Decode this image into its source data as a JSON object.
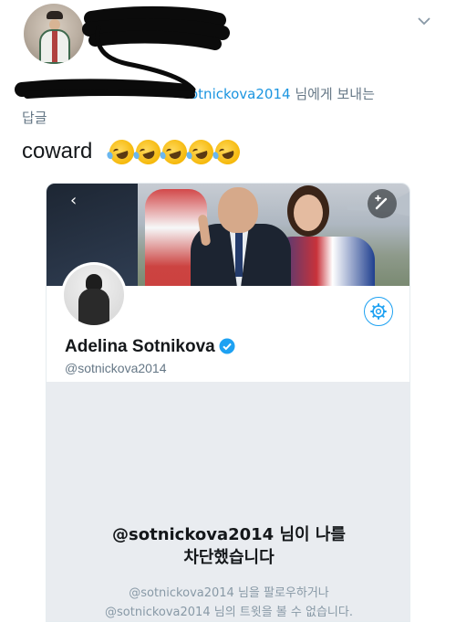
{
  "reply": {
    "handle_visible": "otnickova2014",
    "suffix": " 님에게 보내는",
    "line2": "답글"
  },
  "tweet": {
    "text": "coward",
    "emoji_name": "rolling-on-the-floor-laughing-emoji",
    "emoji_count": 5
  },
  "icons": {
    "chevron": "chevron-down-icon",
    "back": "back-arrow-icon",
    "compose": "compose-icon",
    "settings": "gear-icon",
    "verified": "verified-badge-icon"
  },
  "embedded_profile": {
    "back_glyph": "‹",
    "name": "Adelina Sotnikova",
    "handle": "@sotnickova2014",
    "blocked_title_line1": "@sotnickova2014 님이 나를",
    "blocked_title_line2": "차단했습니다",
    "blocked_sub_line1": "@sotnickova2014 님을 팔로우하거나",
    "blocked_sub_line2": "@sotnickova2014 님의 트윗을 볼 수 없습니다."
  },
  "colors": {
    "link_blue": "#1b95e0",
    "twitter_blue": "#1da1f2",
    "muted_gray": "#657786",
    "blocked_bg": "#e9ecf0"
  }
}
